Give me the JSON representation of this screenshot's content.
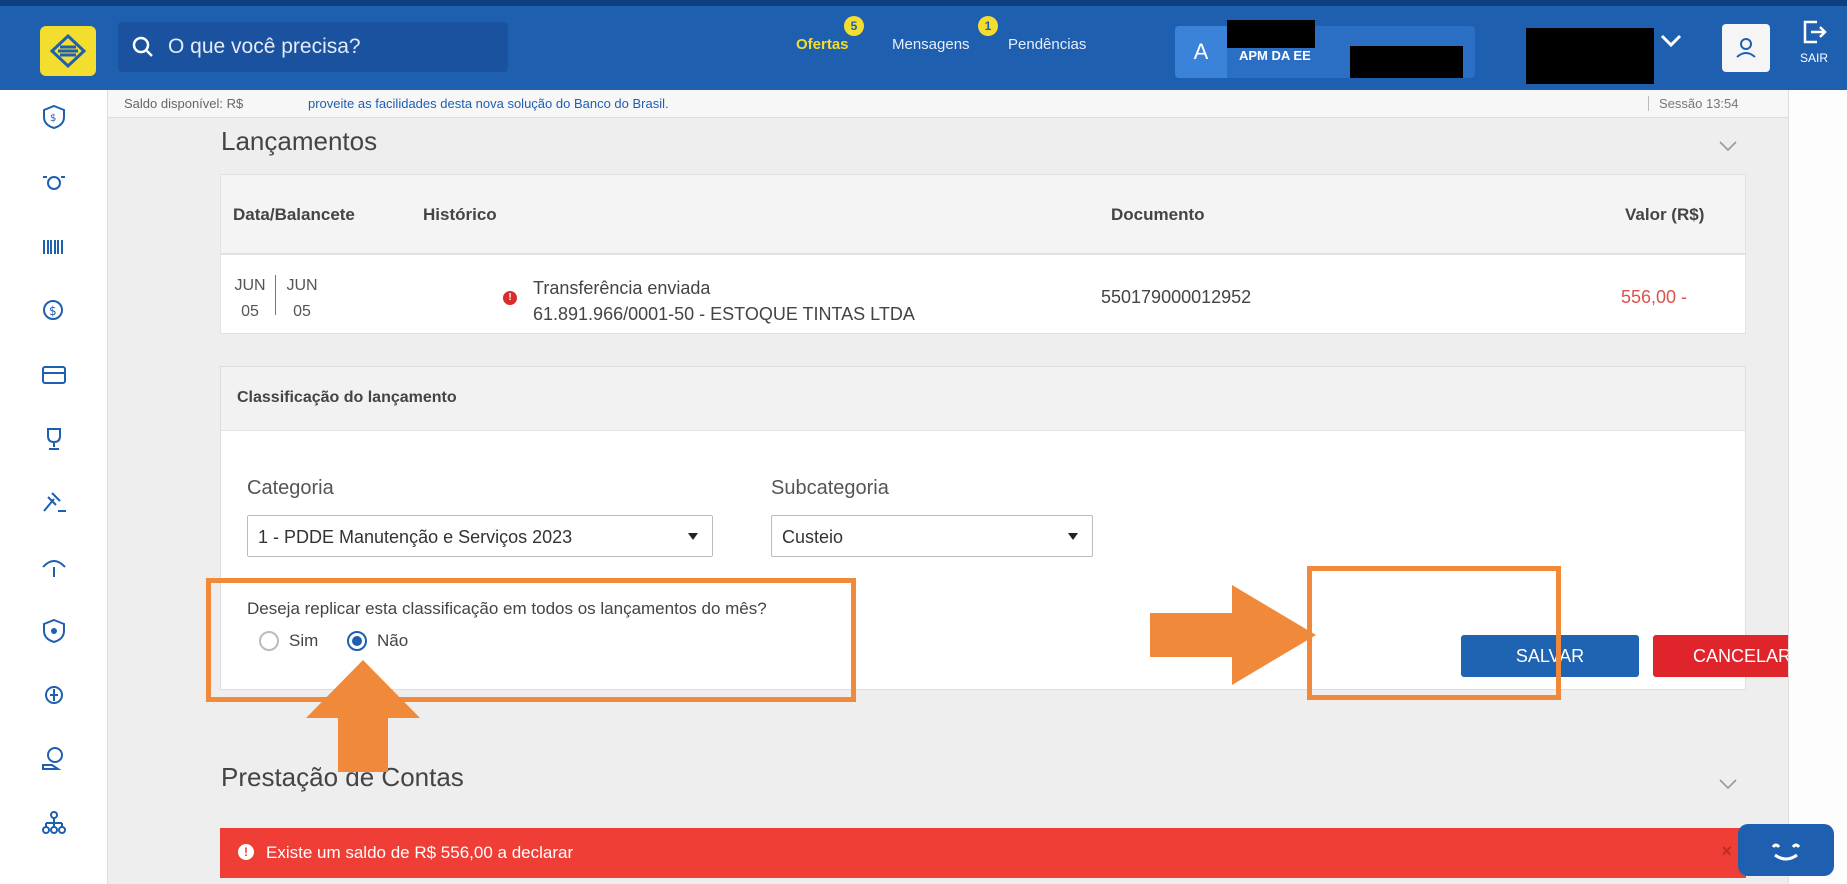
{
  "topbar": {
    "search_placeholder": "O que você precisa?",
    "nav": [
      {
        "label": "Ofertas",
        "badge": "5"
      },
      {
        "label": "Mensagens",
        "badge": "1"
      },
      {
        "label": "Pendências"
      }
    ],
    "avatar_initial": "A",
    "user_name": "APM DA EE",
    "logout_label": "SAIR"
  },
  "infobar": {
    "saldo": "Saldo disponível: R$",
    "promo": "proveite as facilidades desta nova solução do Banco do Brasil.",
    "sessao": "Sessão 13:54"
  },
  "lancamentos": {
    "title": "Lançamentos",
    "columns": [
      "Data/Balancete",
      "Histórico",
      "Documento",
      "Valor (R$)"
    ],
    "row": {
      "month_a": "JUN",
      "day_a": "05",
      "month_b": "JUN",
      "day_b": "05",
      "hist_line1": "Transferência enviada",
      "hist_line2": "61.891.966/0001-50 - ESTOQUE TINTAS LTDA",
      "documento": "550179000012952",
      "valor": "556,00 -"
    }
  },
  "classificacao": {
    "title": "Classificação do lançamento",
    "categoria_label": "Categoria",
    "categoria_value": "1 - PDDE Manutenção e Serviços 2023",
    "subcategoria_label": "Subcategoria",
    "subcategoria_value": "Custeio",
    "replicate_question": "Deseja replicar esta classificação em todos os lançamentos do mês?",
    "option_sim": "Sim",
    "option_nao": "Não",
    "selected": "Não",
    "save_label": "SALVAR",
    "cancel_label": "CANCELAR"
  },
  "prestacao": {
    "title": "Prestação de Contas",
    "alert": "Existe um saldo de R$ 556,00 a declarar"
  },
  "colors": {
    "brand_blue": "#1f5fb0",
    "brand_yellow": "#f3dd2e",
    "danger_red": "#ef3e36",
    "annotation_orange": "#f08a3a"
  },
  "icons": {
    "logo": "bb-logo-icon",
    "search": "search-icon",
    "chevron": "chevron-down-icon",
    "profile": "user-icon",
    "logout": "logout-icon"
  }
}
